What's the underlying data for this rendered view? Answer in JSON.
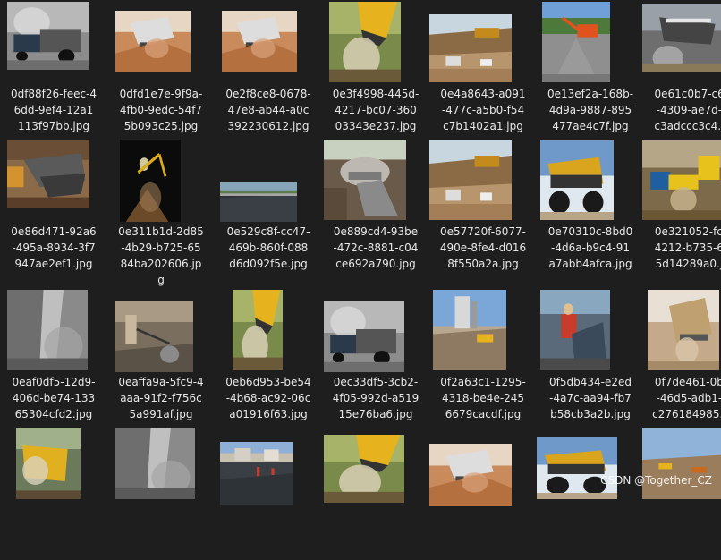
{
  "files": [
    {
      "line1": "0df88f26-feec-4",
      "line2": "6dd-9ef4-12a1",
      "line3": "113f97bb.jpg",
      "theme": "truck-gray"
    },
    {
      "line1": "0dfd1e7e-9f9a-",
      "line2": "4fb0-9edc-54f7",
      "line3": "5b093c25.jpg",
      "theme": "dump-sand"
    },
    {
      "line1": "0e2f8ce8-0678-",
      "line2": "47e8-ab44-a0c",
      "line3": "392230612.jpg",
      "theme": "dump-sand"
    },
    {
      "line1": "0e3f4998-445d-",
      "line2": "4217-bc07-360",
      "line3": "03343e237.jpg",
      "theme": "yellow-dust"
    },
    {
      "line1": "0e4a8643-a091",
      "line2": "-477c-a5b0-f54",
      "line3": "c7b1402a1.jpg",
      "theme": "site-brown"
    },
    {
      "line1": "0e13ef2a-168b-",
      "line2": "4d9a-9887-895",
      "line3": "477ae4c7f.jpg",
      "theme": "excavator-blue"
    },
    {
      "line1": "0e61c0b7-c6ee",
      "line2": "-4309-ae7d-6d",
      "line3": "c3adccc3c4.jpg",
      "theme": "dust-gray"
    },
    {
      "line1": "0e86d471-92a6",
      "line2": "-495a-8934-3f7",
      "line3": "947ae2ef1.jpg",
      "theme": "bucket-dark"
    },
    {
      "line1": "0e311b1d-2d85",
      "line2": "-4b29-b725-65",
      "line3": "84ba202606.jp",
      "line4": "g",
      "theme": "night"
    },
    {
      "line1": "0e529c8f-cc47-",
      "line2": "469b-860f-088",
      "line3": "d6d092f5e.jpg",
      "theme": "road"
    },
    {
      "line1": "0e889cd4-93be",
      "line2": "-472c-8881-c04",
      "line3": "ce692a790.jpg",
      "theme": "mixer"
    },
    {
      "line1": "0e57720f-6077-",
      "line2": "490e-8fe4-d016",
      "line3": "8f550a2a.jpg",
      "theme": "site-brown"
    },
    {
      "line1": "0e70310c-8bd0",
      "line2": "-4d6a-b9c4-91",
      "line3": "a7abb4afca.jpg",
      "theme": "haul-blue"
    },
    {
      "line1": "0e321052-fcf9-",
      "line2": "4212-b735-668",
      "line3": "5d14289a0.jpg",
      "theme": "truck-yellow"
    },
    {
      "line1": "0eaf0df5-12d9-",
      "line2": "406d-be74-133",
      "line3": "65304cfd2.jpg",
      "theme": "chute"
    },
    {
      "line1": "0eaffa9a-5fc9-4",
      "line2": "aaa-91f2-f756c",
      "line3": "5a991af.jpg",
      "theme": "worker"
    },
    {
      "line1": "0eb6d953-be54",
      "line2": "-4b68-ac92-06c",
      "line3": "a01916f63.jpg",
      "theme": "yellow-dust"
    },
    {
      "line1": "0ec33df5-3cb2-",
      "line2": "4f05-992d-a519",
      "line3": "15e76ba6.jpg",
      "theme": "truck-gray"
    },
    {
      "line1": "0f2a63c1-1295-",
      "line2": "4318-be4e-245",
      "line3": "6679cacdf.jpg",
      "theme": "plant"
    },
    {
      "line1": "0f5db434-e2ed",
      "line2": "-4a7c-aa94-fb7",
      "line3": "b58cb3a2b.jpg",
      "theme": "worker-red"
    },
    {
      "line1": "0f7de461-0b90",
      "line2": "-46d5-adb1-b0",
      "line3": "c276184985.jpg",
      "theme": "bucket-light"
    },
    {
      "line1": "",
      "line2": "",
      "line3": "",
      "theme": "truck-yellow2"
    },
    {
      "line1": "",
      "line2": "",
      "line3": "",
      "theme": "chute"
    },
    {
      "line1": "",
      "line2": "",
      "line3": "",
      "theme": "road-people"
    },
    {
      "line1": "",
      "line2": "",
      "line3": "",
      "theme": "yellow-dust"
    },
    {
      "line1": "",
      "line2": "",
      "line3": "",
      "theme": "dump-sand"
    },
    {
      "line1": "",
      "line2": "",
      "line3": "",
      "theme": "haul-blue"
    },
    {
      "line1": "",
      "line2": "",
      "line3": "",
      "theme": "site-sky"
    }
  ],
  "watermark": "CSDN @Together_CZ"
}
